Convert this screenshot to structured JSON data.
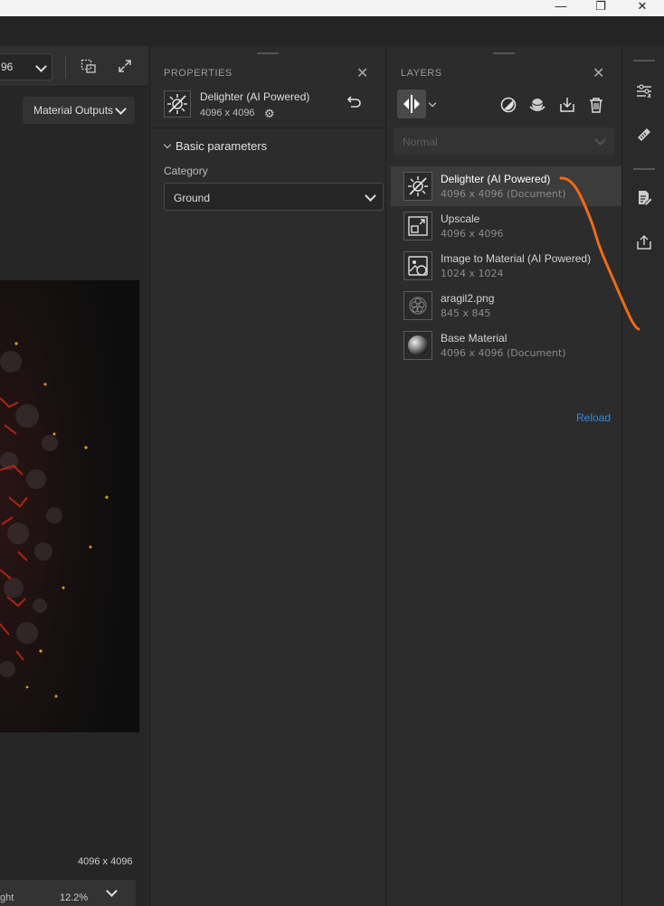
{
  "window": {
    "controls": [
      "—",
      "❐",
      "✕"
    ]
  },
  "viewport": {
    "resolution_select": "96",
    "material_outputs_label": "Material Outputs",
    "resolution_text": "4096 x 4096",
    "bottom_light_label": "ght",
    "zoom_level": "12.2%"
  },
  "properties": {
    "title": "PROPERTIES",
    "layer_name": "Delighter (AI Powered)",
    "layer_size": "4096 x 4096",
    "section_label": "Basic parameters",
    "category_label": "Category",
    "category_value": "Ground"
  },
  "layers": {
    "title": "LAYERS",
    "blend_mode_placeholder": "Normal",
    "items": [
      {
        "name": "Delighter (AI Powered)",
        "size": "4096 x 4096 (Document)",
        "icon": "delight-icon",
        "selected": true
      },
      {
        "name": "Upscale",
        "size": "4096 x 4096",
        "icon": "upscale-icon",
        "selected": false
      },
      {
        "name": "Image to Material (AI Powered)",
        "size": "1024 x 1024",
        "icon": "image-to-material-icon",
        "selected": false
      },
      {
        "name": "aragil2.png",
        "size": "845 x 845",
        "icon": "image-thumbnail-icon",
        "selected": false
      },
      {
        "name": "Base Material",
        "size": "4096 x 4096 (Document)",
        "icon": "sphere-icon",
        "selected": false
      }
    ],
    "reload_label": "Reload"
  },
  "colors": {
    "accent_blue": "#2d8ceb",
    "annotation_stroke": "#f26a14",
    "panel_bg": "#2c2c2c"
  }
}
